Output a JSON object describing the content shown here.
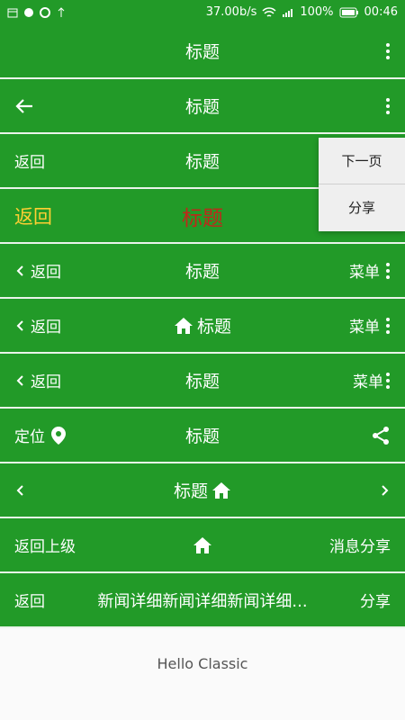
{
  "status": {
    "speed": "37.00b/s",
    "battery": "100%",
    "time": "00:46"
  },
  "bars": [
    {
      "title": "标题"
    },
    {
      "title": "标题"
    },
    {
      "left": "返回",
      "title": "标题"
    },
    {
      "left": "返回",
      "title": "标题"
    },
    {
      "left": "返回",
      "title": "标题",
      "right": "菜单"
    },
    {
      "left": "返回",
      "title": "标题",
      "right": "菜单"
    },
    {
      "left": "返回",
      "title": "标题",
      "right": "菜单"
    },
    {
      "left": "定位",
      "title": "标题"
    },
    {
      "title": "标题"
    },
    {
      "left": "返回上级",
      "right": "消息分享"
    },
    {
      "left": "返回",
      "title": "新闻详细新闻详细新闻详细...",
      "right": "分享"
    }
  ],
  "popup": {
    "next": "下一页",
    "share": "分享"
  },
  "content": {
    "text": "Hello Classic"
  },
  "colors": {
    "primary": "#229a28",
    "popup_bg": "#efefef"
  }
}
